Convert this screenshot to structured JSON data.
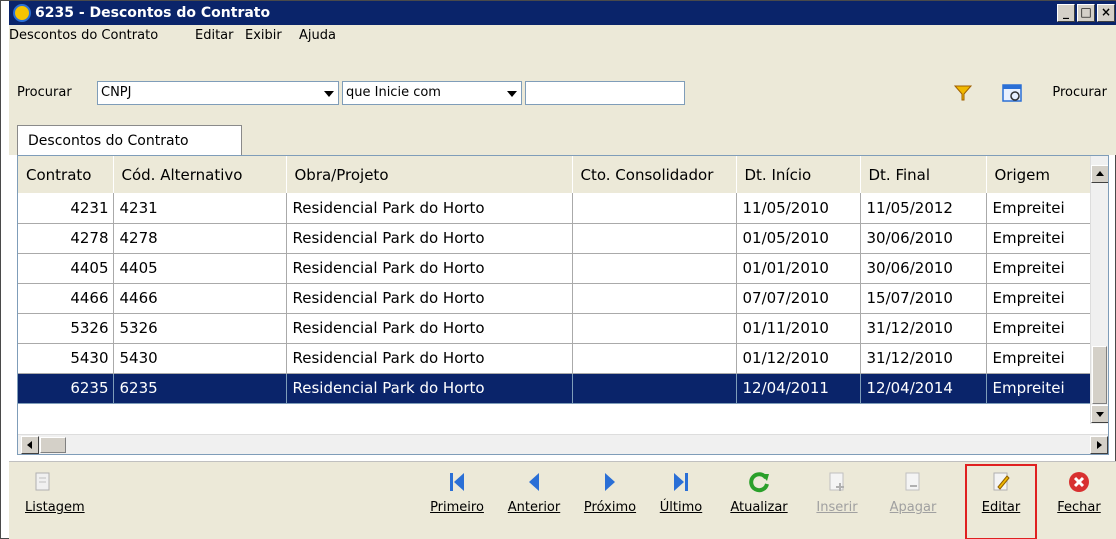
{
  "window": {
    "title": "6235 - Descontos do Contrato",
    "buttons": [
      "_",
      "□",
      "×"
    ]
  },
  "menu": [
    "Descontos do Contrato",
    "Editar",
    "Exibir",
    "Ajuda"
  ],
  "search": {
    "label": "Procurar",
    "field_value": "CNPJ",
    "condition_value": "que Inicie com",
    "query_value": "",
    "button_label": "Procurar"
  },
  "tab": {
    "label": "Descontos do Contrato"
  },
  "table": {
    "headers": [
      "Contrato",
      "Cód. Alternativo",
      "Obra/Projeto",
      "Cto. Consolidador",
      "Dt. Início",
      "Dt. Final",
      "Origem"
    ],
    "rows": [
      [
        "4231",
        "4231",
        "Residencial Park do Horto",
        "",
        "11/05/2010",
        "11/05/2012",
        "Empreitei"
      ],
      [
        "4278",
        "4278",
        "Residencial Park do Horto",
        "",
        "01/05/2010",
        "30/06/2010",
        "Empreitei"
      ],
      [
        "4405",
        "4405",
        "Residencial Park do Horto",
        "",
        "01/01/2010",
        "30/06/2010",
        "Empreitei"
      ],
      [
        "4466",
        "4466",
        "Residencial Park do Horto",
        "",
        "07/07/2010",
        "15/07/2010",
        "Empreitei"
      ],
      [
        "5326",
        "5326",
        "Residencial Park do Horto",
        "",
        "01/11/2010",
        "31/12/2010",
        "Empreitei"
      ],
      [
        "5430",
        "5430",
        "Residencial Park do Horto",
        "",
        "01/12/2010",
        "31/12/2010",
        "Empreitei"
      ],
      [
        "6235",
        "6235",
        "Residencial Park do Horto",
        "",
        "12/04/2011",
        "12/04/2014",
        "Empreitei"
      ]
    ],
    "selected_row": 6
  },
  "bottom": {
    "listagem": "Listagem",
    "primeiro": "Primeiro",
    "anterior": "Anterior",
    "proximo": "Próximo",
    "ultimo": "Último",
    "atualizar": "Atualizar",
    "inserir": "Inserir",
    "apagar": "Apagar",
    "editar": "Editar",
    "fechar": "Fechar"
  },
  "colors": {
    "title_bg": "#0a246a",
    "selected_row_bg": "#0a246a",
    "nav_blue": "#2a6fd6",
    "refresh_green": "#2aa02a",
    "close_red": "#d83030",
    "highlight_red": "#e02020",
    "filter_yellow": "#f0b800"
  },
  "icons": {
    "app": "app-icon",
    "filter": "filter-icon",
    "search": "search-icon",
    "listagem": "document-icon",
    "primeiro": "first-record-icon",
    "anterior": "previous-record-icon",
    "proximo": "next-record-icon",
    "ultimo": "last-record-icon",
    "atualizar": "refresh-icon",
    "inserir": "insert-icon",
    "apagar": "delete-icon",
    "editar": "edit-icon",
    "fechar": "close-icon"
  }
}
